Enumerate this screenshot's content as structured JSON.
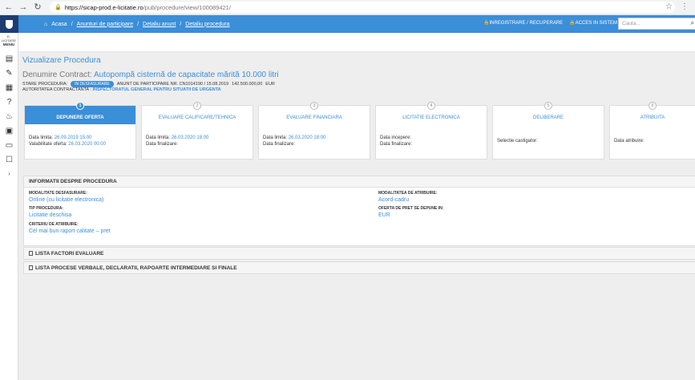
{
  "browser": {
    "url_host": "https://sicap-prod.e-licitatie.ro",
    "url_path": "/pub/procedure/view/100089421/"
  },
  "sidebar": {
    "menu_top": "E-LICITATIE",
    "menu_label": "MENIU"
  },
  "topbar": {
    "breadcrumb": [
      "Acasa",
      "Anunturi de participare",
      "Detaliu anunt",
      "Detaliu procedura"
    ],
    "register_link": "INREGISTRARE / RECUPERARE",
    "login_link": "ACCES IN SISTEM",
    "search_placeholder": "Cauta..."
  },
  "page": {
    "title": "Vizualizare Procedura",
    "contract_label": "Denumire Contract:",
    "contract_name": "Autopompă cisternă de capacitate mărită 10.000 litri",
    "status_label": "STARE PROCEDURA:",
    "status_value": "IN DESFASURARE",
    "notice": "ANUNT DE PARTICIPARE NR. CN1014190 / 15.08.2019",
    "value": "142.500.000,00",
    "currency": "EUR",
    "authority_label": "AUTORITATEA CONTRACTANTA :",
    "authority_value": "INSPECTORATUL GENERAL PENTRU SITUATII DE URGENTA"
  },
  "steps": [
    {
      "num": "1",
      "title": "DEPUNERE OFERTA",
      "lines": [
        {
          "label": "Data limita:",
          "value": "26.09.2019 15:00"
        },
        {
          "label": "Valabilitate oferta:",
          "value": "26.03.2020 00:00"
        }
      ]
    },
    {
      "num": "2",
      "title": "EVALUARE CALIFICARE/TEHNICA",
      "lines": [
        {
          "label": "Data limita:",
          "value": "26.03.2020 18:00"
        },
        {
          "label": "Data finalizare:",
          "value": ""
        }
      ]
    },
    {
      "num": "3",
      "title": "EVALUARE FINANCIARA",
      "lines": [
        {
          "label": "Data limita:",
          "value": "26.03.2020 18:00"
        },
        {
          "label": "Data finalizare:",
          "value": ""
        }
      ]
    },
    {
      "num": "4",
      "title": "LICITATIE ELECTRONICA",
      "lines": [
        {
          "label": "Data incepere:",
          "value": ""
        },
        {
          "label": "Data finalizare:",
          "value": ""
        }
      ]
    },
    {
      "num": "5",
      "title": "DELIBERARE",
      "lines": [
        {
          "label": "Selectie castigator:",
          "value": ""
        }
      ]
    },
    {
      "num": "6",
      "title": "ATRIBUITA",
      "lines": [
        {
          "label": "Data atribuire:",
          "value": ""
        }
      ]
    }
  ],
  "info": {
    "header": "INFORMATII DESPRE PROCEDURA",
    "modalitate_label": "MODALITATE DESFASURARE:",
    "modalitate_value": "Online (cu licitatie electronica)",
    "tip_label": "TIP PROCEDURA:",
    "tip_value": "Licitatie deschisa",
    "criteriu_label": "CRITERIU DE ATRIBUIRE:",
    "criteriu_value": "Cel mai bun raport calitate – pret",
    "atribuire_label": "MODALITATEA DE ATRIBUIRE:",
    "atribuire_value": "Acord-cadru",
    "moneda_label": "OFERTA DE PRET SE DEPUNE IN:",
    "moneda_value": "EUR"
  },
  "sections": {
    "factori": "LISTA FACTORI EVALUARE",
    "procese": "LISTA PROCESE VERBALE, DECLARATII, RAPOARTE INTERMEDIARE SI FINALE"
  }
}
